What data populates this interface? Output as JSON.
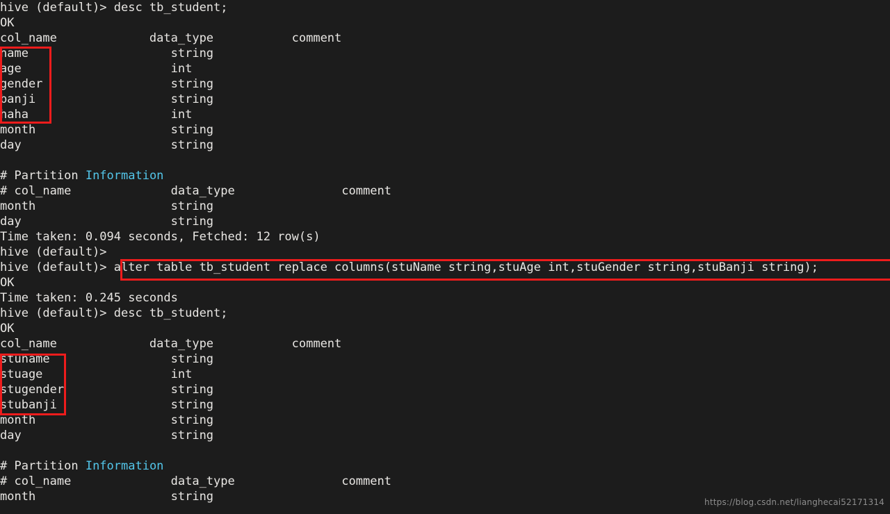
{
  "terminal": {
    "prompt": "hive (default)> ",
    "colors": {
      "background": "#1c1c1c",
      "foreground": "#e8e6e3",
      "cyan": "#53c6ea",
      "annotation_red": "#ee1c1c",
      "watermark": "#8d8d8d"
    },
    "lines": [
      {
        "id": "l00",
        "text": "hive (default)> desc tb_student;"
      },
      {
        "id": "l01",
        "text": "OK"
      },
      {
        "id": "l02",
        "text": "col_name             data_type           comment"
      },
      {
        "id": "l03",
        "text": "name                    string"
      },
      {
        "id": "l04",
        "text": "age                     int"
      },
      {
        "id": "l05",
        "text": "gender                  string"
      },
      {
        "id": "l06",
        "text": "banji                   string"
      },
      {
        "id": "l07",
        "text": "haha                    int"
      },
      {
        "id": "l08",
        "text": "month                   string"
      },
      {
        "id": "l09",
        "text": "day                     string"
      },
      {
        "id": "l10",
        "text": ""
      },
      {
        "id": "l11",
        "text": "# Partition ",
        "cyan_text": "Information"
      },
      {
        "id": "l12",
        "text": "# col_name              data_type               comment"
      },
      {
        "id": "l13",
        "text": "month                   string"
      },
      {
        "id": "l14",
        "text": "day                     string"
      },
      {
        "id": "l15",
        "text": "Time taken: 0.094 seconds, Fetched: 12 row(s)"
      },
      {
        "id": "l16",
        "text": "hive (default)>"
      },
      {
        "id": "l17",
        "text": "hive (default)> alter table tb_student replace columns(stuName string,stuAge int,stuGender string,stuBanji string);"
      },
      {
        "id": "l18",
        "text": "OK"
      },
      {
        "id": "l19",
        "text": "Time taken: 0.245 seconds"
      },
      {
        "id": "l20",
        "text": "hive (default)> desc tb_student;"
      },
      {
        "id": "l21",
        "text": "OK"
      },
      {
        "id": "l22",
        "text": "col_name             data_type           comment"
      },
      {
        "id": "l23",
        "text": "stuname                 string"
      },
      {
        "id": "l24",
        "text": "stuage                  int"
      },
      {
        "id": "l25",
        "text": "stugender               string"
      },
      {
        "id": "l26",
        "text": "stubanji                string"
      },
      {
        "id": "l27",
        "text": "month                   string"
      },
      {
        "id": "l28",
        "text": "day                     string"
      },
      {
        "id": "l29",
        "text": ""
      },
      {
        "id": "l30",
        "text": "# Partition ",
        "cyan_text": "Information"
      },
      {
        "id": "l31",
        "text": "# col_name              data_type               comment"
      },
      {
        "id": "l32",
        "text": "month                   string"
      }
    ],
    "commands": {
      "desc_before": "desc tb_student;",
      "alter_replace_columns": "alter table tb_student replace columns(stuName string,stuAge int,stuGender string,stuBanji string);",
      "desc_after": "desc tb_student;"
    },
    "results": {
      "ok": "OK",
      "time_taken_desc_before": "Time taken: 0.094 seconds, Fetched: 12 row(s)",
      "time_taken_alter": "Time taken: 0.245 seconds"
    },
    "schema_before": {
      "headers": [
        "col_name",
        "data_type",
        "comment"
      ],
      "rows": [
        [
          "name",
          "string",
          ""
        ],
        [
          "age",
          "int",
          ""
        ],
        [
          "gender",
          "string",
          ""
        ],
        [
          "banji",
          "string",
          ""
        ],
        [
          "haha",
          "int",
          ""
        ],
        [
          "month",
          "string",
          ""
        ],
        [
          "day",
          "string",
          ""
        ]
      ],
      "partition_title": "# Partition Information",
      "partition_headers": [
        "# col_name",
        "data_type",
        "comment"
      ],
      "partition_rows": [
        [
          "month",
          "string",
          ""
        ],
        [
          "day",
          "string",
          ""
        ]
      ]
    },
    "schema_after": {
      "headers": [
        "col_name",
        "data_type",
        "comment"
      ],
      "rows": [
        [
          "stuname",
          "string",
          ""
        ],
        [
          "stuage",
          "int",
          ""
        ],
        [
          "stugender",
          "string",
          ""
        ],
        [
          "stubanji",
          "string",
          ""
        ],
        [
          "month",
          "string",
          ""
        ],
        [
          "day",
          "string",
          ""
        ]
      ],
      "partition_title": "# Partition Information",
      "partition_headers": [
        "# col_name",
        "data_type",
        "comment"
      ],
      "partition_rows": [
        [
          "month",
          "string",
          ""
        ]
      ]
    },
    "annotations": [
      {
        "id": "redbox-cols-before",
        "label": "highlighted original columns"
      },
      {
        "id": "redbox-alter-cmd",
        "label": "highlighted alter table statement"
      },
      {
        "id": "redbox-cols-after",
        "label": "highlighted replaced columns"
      }
    ],
    "watermark": "https://blog.csdn.net/lianghecai52171314"
  }
}
